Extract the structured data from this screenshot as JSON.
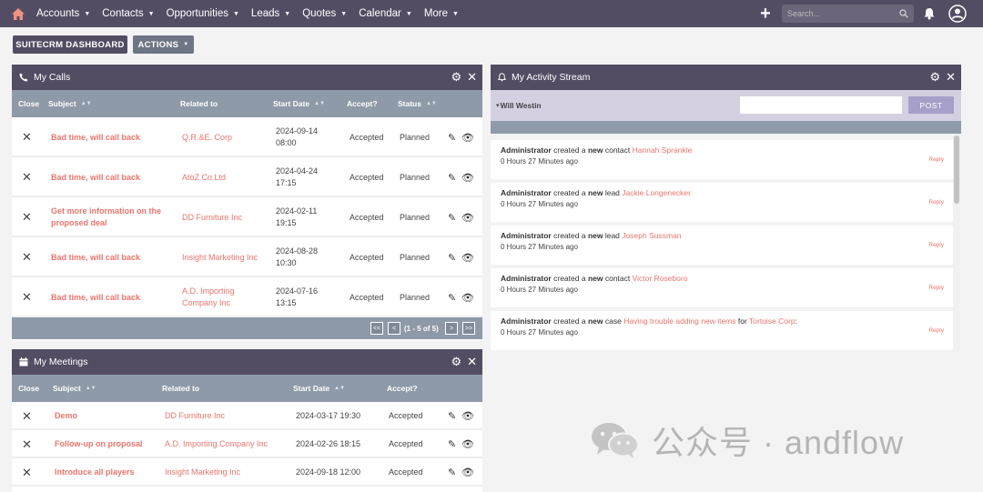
{
  "nav": {
    "items": [
      "Accounts",
      "Contacts",
      "Opportunities",
      "Leads",
      "Quotes",
      "Calendar",
      "More"
    ],
    "search_placeholder": "Search..."
  },
  "toolbar": {
    "dashboard_label": "SUITECRM DASHBOARD",
    "actions_label": "ACTIONS"
  },
  "calls": {
    "title": "My Calls",
    "columns": {
      "close": "Close",
      "subject": "Subject",
      "related": "Related to",
      "start": "Start Date",
      "accept": "Accept?",
      "status": "Status"
    },
    "rows": [
      {
        "subject": "Bad time, will call back",
        "related": "Q.R.&E. Corp",
        "date": "2024-09-14",
        "time": "08:00",
        "accept": "Accepted",
        "status": "Planned"
      },
      {
        "subject": "Bad time, will call back",
        "related": "AtoZ Co Ltd",
        "date": "2024-04-24",
        "time": "17:15",
        "accept": "Accepted",
        "status": "Planned"
      },
      {
        "subject": "Get more information on the proposed deal",
        "related": "DD Furniture Inc",
        "date": "2024-02-11",
        "time": "19:15",
        "accept": "Accepted",
        "status": "Planned"
      },
      {
        "subject": "Bad time, will call back",
        "related": "Insight Marketing Inc",
        "date": "2024-08-28",
        "time": "10:30",
        "accept": "Accepted",
        "status": "Planned"
      },
      {
        "subject": "Bad time, will call back",
        "related": "A.D. Importing Company Inc",
        "date": "2024-07-16",
        "time": "13:15",
        "accept": "Accepted",
        "status": "Planned"
      }
    ],
    "pager": {
      "first": "<<",
      "prev": "<",
      "range": "(1 - 5 of 5)",
      "next": ">",
      "last": ">>"
    }
  },
  "meetings": {
    "title": "My Meetings",
    "columns": {
      "close": "Close",
      "subject": "Subject",
      "related": "Related to",
      "start": "Start Date",
      "accept": "Accept?"
    },
    "rows": [
      {
        "subject": "Demo",
        "related": "DD Furniture Inc",
        "start": "2024-03-17 19:30",
        "accept": "Accepted"
      },
      {
        "subject": "Follow-up on proposal",
        "related": "A.D. Importing Company Inc",
        "start": "2024-02-26 18:15",
        "accept": "Accepted"
      },
      {
        "subject": "Introduce all players",
        "related": "Insight Marketing Inc",
        "start": "2024-09-18 12:00",
        "accept": "Accepted"
      }
    ]
  },
  "activity": {
    "title": "My Activity Stream",
    "user": "Will Westin",
    "post_label": "POST",
    "entries": [
      {
        "actor": "Administrator",
        "verb": "created a",
        "new": "new",
        "type": "contact",
        "target": "Hannah Sprankle",
        "time": "0 Hours 27 Minutes ago",
        "reply": "Reply"
      },
      {
        "actor": "Administrator",
        "verb": "created a",
        "new": "new",
        "type": "lead",
        "target": "Jackie Longenecker",
        "time": "0 Hours 27 Minutes ago",
        "reply": "Reply"
      },
      {
        "actor": "Administrator",
        "verb": "created a",
        "new": "new",
        "type": "lead",
        "target": "Joseph Sussman",
        "time": "0 Hours 27 Minutes ago",
        "reply": "Reply"
      },
      {
        "actor": "Administrator",
        "verb": "created a",
        "new": "new",
        "type": "contact",
        "target": "Victor Roseboro",
        "time": "0 Hours 27 Minutes ago",
        "reply": "Reply"
      },
      {
        "actor": "Administrator",
        "verb": "created a",
        "new": "new",
        "type": "case",
        "target": "Having trouble adding new items",
        "for": "for",
        "account": "Tortoise Corp",
        "suffix": ":",
        "time": "0 Hours 27 Minutes ago",
        "reply": "Reply"
      }
    ]
  },
  "watermark": {
    "text": "公众号 · andflow"
  },
  "colors": {
    "nav": "#534d64",
    "header_row": "#8e9aa8",
    "link": "#e9756d",
    "post_button": "#a69fc9"
  }
}
